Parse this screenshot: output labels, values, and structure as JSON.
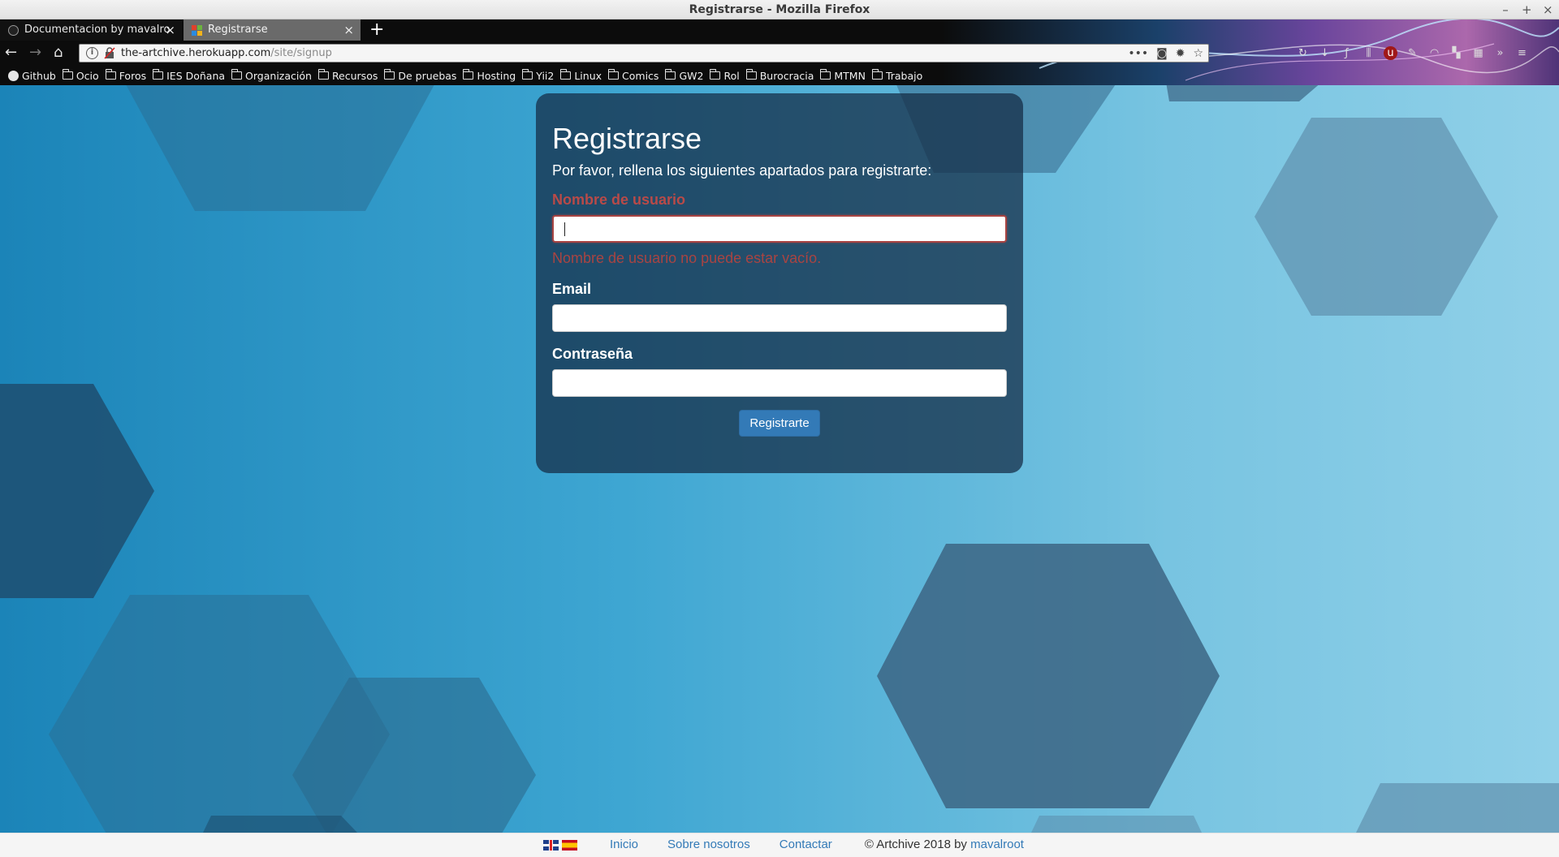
{
  "window": {
    "title": "Registrarse - Mozilla Firefox",
    "controls": [
      "–",
      "+",
      "×"
    ]
  },
  "tabs": [
    {
      "label": "Documentacion by mavalro",
      "close": "×"
    },
    {
      "label": "Registrarse",
      "close": "×"
    }
  ],
  "newtab": "+",
  "nav": {
    "back": "←",
    "forward": "→",
    "home": "⌂",
    "info": "i",
    "actions": "•••"
  },
  "url": {
    "host": "the-artchive.herokuapp.com",
    "path": "/site/signup"
  },
  "bookmarks": [
    "Github",
    "Ocio",
    "Foros",
    "IES Doñana",
    "Organización",
    "Recursos",
    "De pruebas",
    "Hosting",
    "Yii2",
    "Linux",
    "Comics",
    "GW2",
    "Rol",
    "Burocracia",
    "MTMN",
    "Trabajo"
  ],
  "form": {
    "title": "Registrarse",
    "intro": "Por favor, rellena los siguientes apartados para registrarte:",
    "username_label": "Nombre de usuario",
    "username_value": "",
    "username_error": "Nombre de usuario no puede estar vacío.",
    "email_label": "Email",
    "email_value": "",
    "password_label": "Contraseña",
    "password_value": "",
    "submit_label": "Registrarte"
  },
  "footer": {
    "links": [
      "Inicio",
      "Sobre nosotros",
      "Contactar"
    ],
    "copyright": "© Artchive 2018 by ",
    "author": "mavalroot"
  },
  "colors": {
    "accent": "#337ab7",
    "error": "#a94442",
    "card_bg": "#142a42"
  }
}
